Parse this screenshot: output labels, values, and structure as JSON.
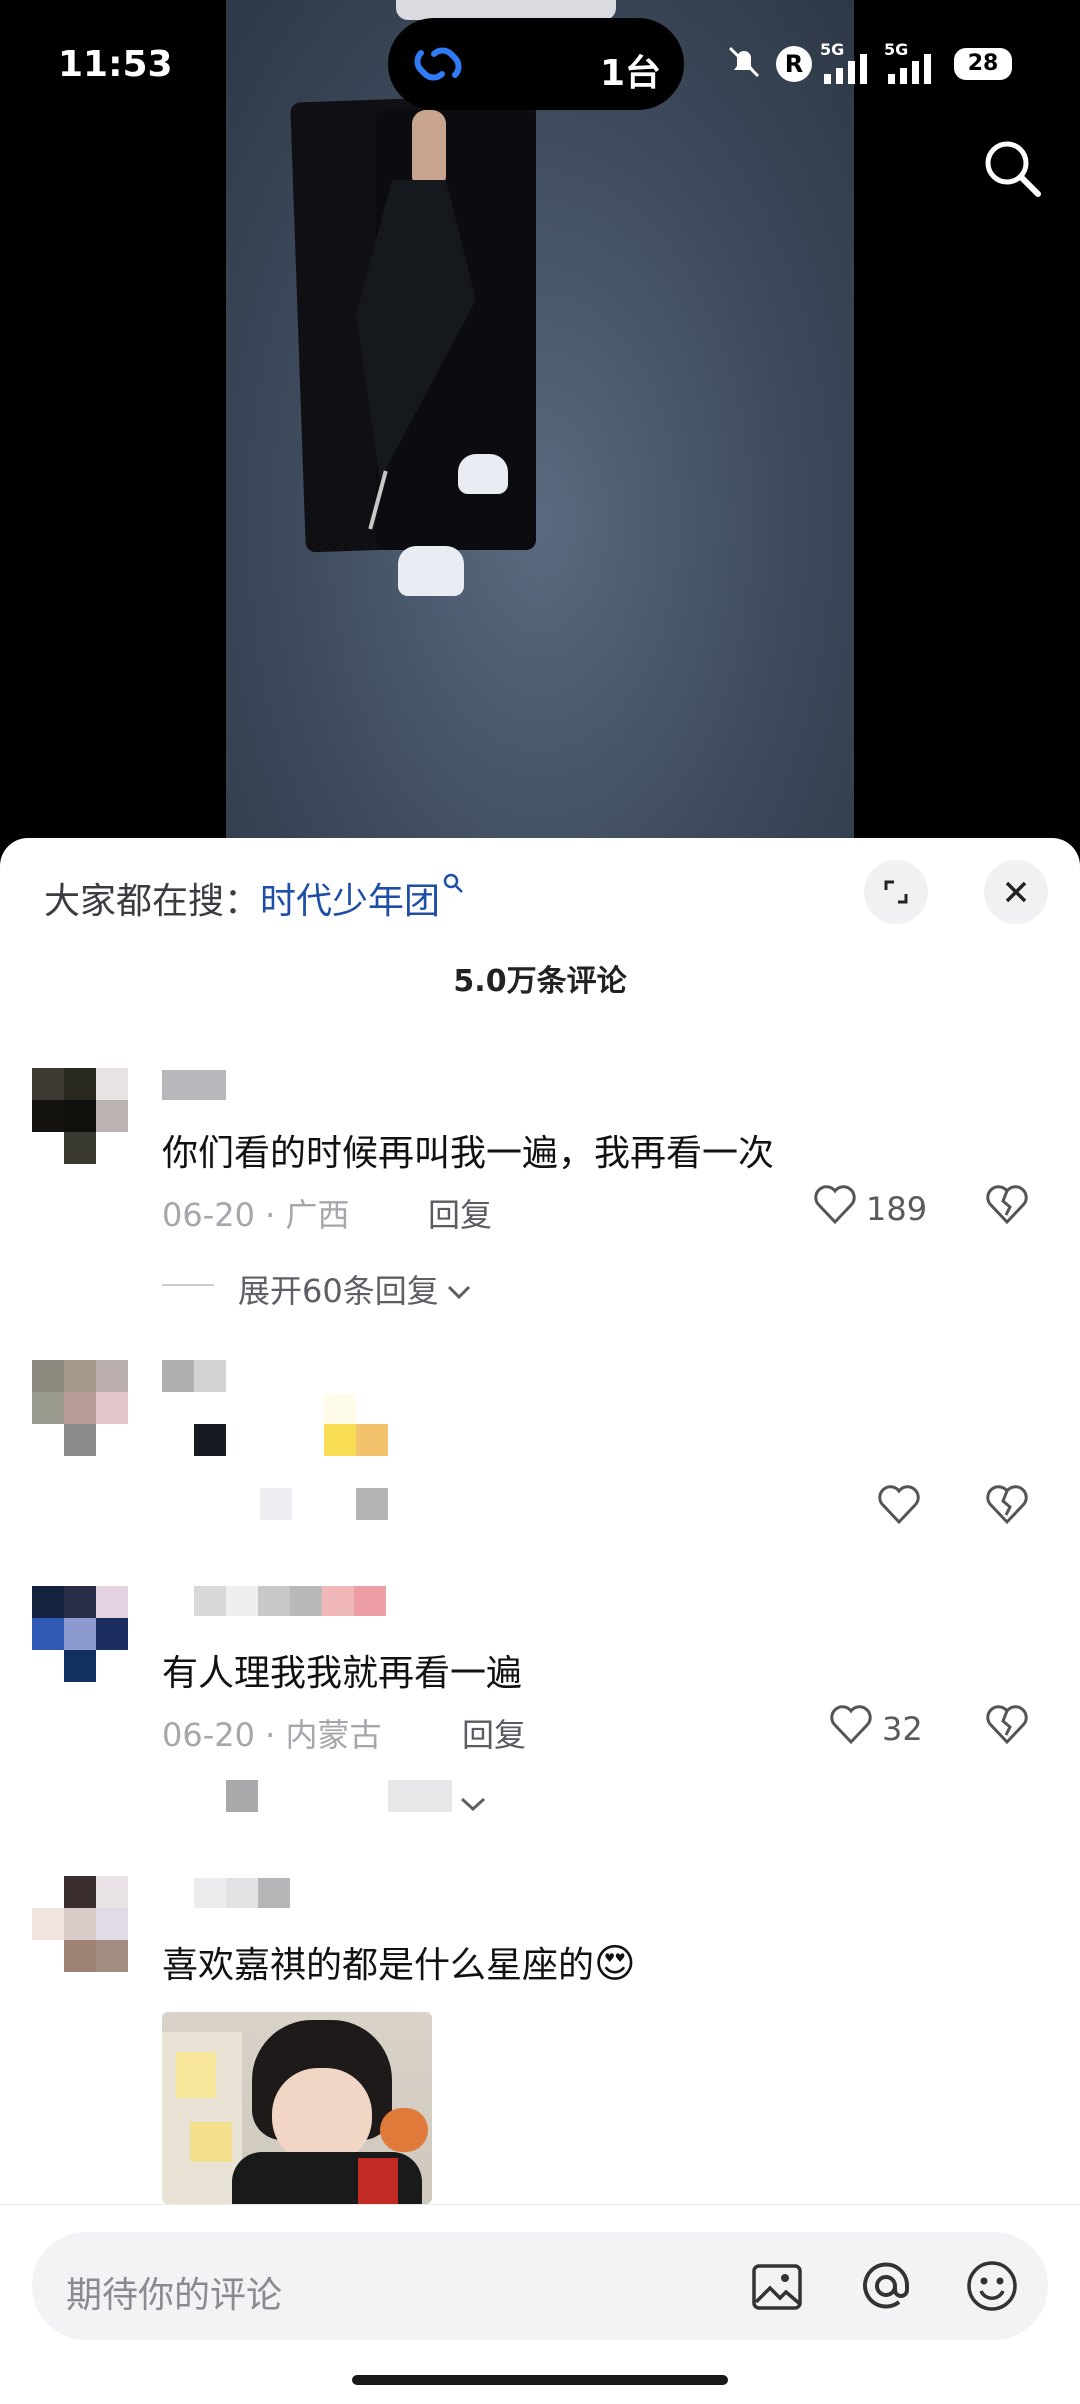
{
  "status_bar": {
    "time": "11:53",
    "island_label": "1台",
    "battery": "28",
    "signal_label": "5G"
  },
  "search_hint": {
    "prefix": "大家都在搜：",
    "term": "时代少年团"
  },
  "comments_header": {
    "count_label": "5.0万条评论"
  },
  "comments": [
    {
      "text": "你们看的时候再叫我一遍，我再看一次",
      "date": "06-20",
      "location": "广西",
      "reply_label": "回复",
      "likes": "189",
      "expand_label": "展开60条回复"
    },
    {
      "text": "",
      "likes": ""
    },
    {
      "text": "有人理我我就再看一遍",
      "date": "06-20",
      "location": "内蒙古",
      "reply_label": "回复",
      "likes": "32"
    },
    {
      "text": "喜欢嘉祺的都是什么星座的",
      "emoji": "😍"
    }
  ],
  "input": {
    "placeholder": "期待你的评论"
  },
  "icons": {
    "link": "link-icon",
    "search": "search-icon",
    "expand": "expand-icon",
    "close": "close-icon",
    "heart": "heart-icon",
    "dislike": "broken-heart-icon",
    "image": "image-icon",
    "at": "at-icon",
    "emoji": "smile-icon"
  },
  "colors": {
    "accent_link": "#1f4ea6",
    "text_primary": "#111111",
    "text_muted": "#a6a6ad"
  }
}
